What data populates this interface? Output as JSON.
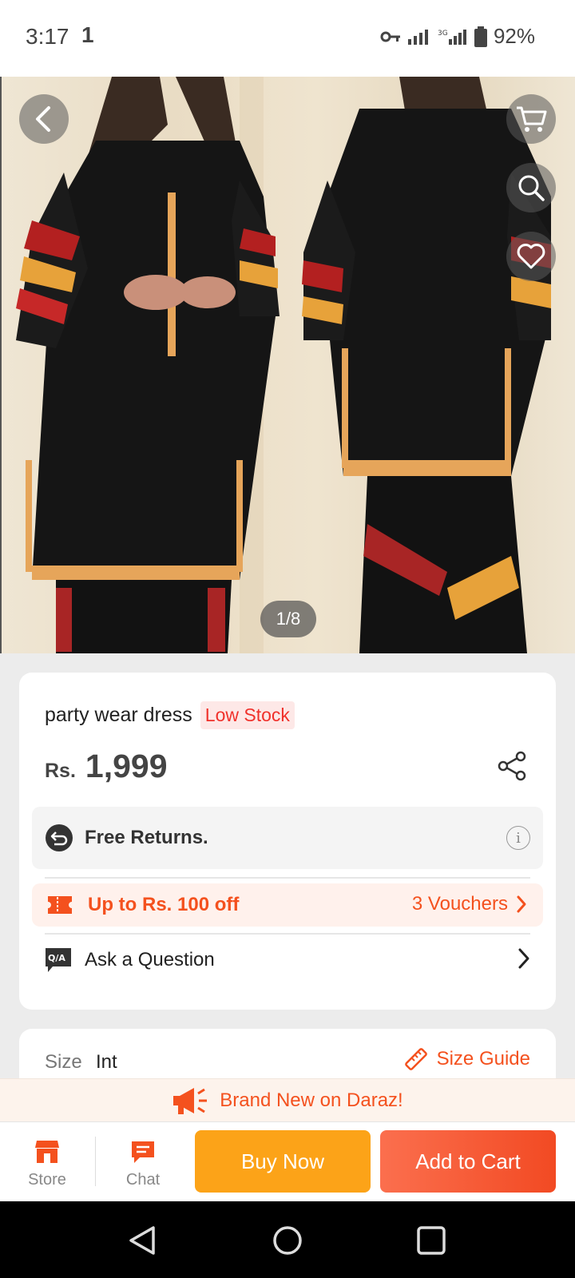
{
  "status_bar": {
    "time": "3:17",
    "notification": "1",
    "battery": "92%",
    "network": "3G"
  },
  "gallery": {
    "counter": "1/8"
  },
  "product": {
    "title": "party wear dress",
    "stock_badge": "Low Stock",
    "currency": "Rs.",
    "price": "1,999"
  },
  "returns": {
    "label": "Free Returns."
  },
  "voucher": {
    "label": "Up to Rs. 100 off",
    "count": "3 Vouchers"
  },
  "ask": {
    "label": "Ask a Question",
    "icon_text": "Q/A"
  },
  "size": {
    "label": "Size",
    "value": "Int",
    "guide": "Size Guide"
  },
  "banner": {
    "text": "Brand New on Daraz!"
  },
  "bottom_bar": {
    "store": "Store",
    "chat": "Chat",
    "buy_now": "Buy Now",
    "add_to_cart": "Add to Cart"
  },
  "colors": {
    "accent": "#f4511e",
    "buy": "#fca318",
    "cart": "#f24a23",
    "low_stock": "#f0312b"
  }
}
